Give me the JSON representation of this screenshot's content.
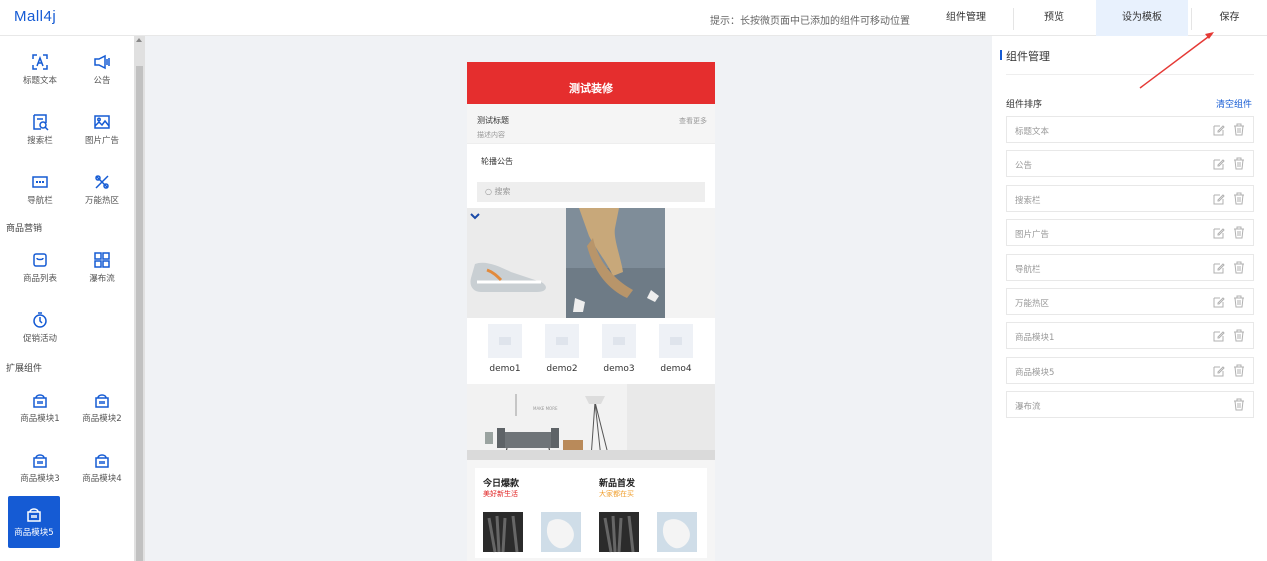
{
  "app": {
    "logo": "Mall4j"
  },
  "topbar": {
    "hint": "提示：长按微页面中已添加的组件可移动位置",
    "component_manage": "组件管理",
    "preview": "预览",
    "set_template": "设为模板",
    "save": "保存"
  },
  "sidebar": {
    "basic": [
      {
        "label": "标题文本",
        "icon": "title-text-icon"
      },
      {
        "label": "公告",
        "icon": "notice-icon"
      },
      {
        "label": "搜索栏",
        "icon": "search-bar-icon"
      },
      {
        "label": "图片广告",
        "icon": "image-ad-icon"
      },
      {
        "label": "导航栏",
        "icon": "navbar-icon"
      },
      {
        "label": "万能热区",
        "icon": "hotzone-icon"
      }
    ],
    "marketing_title": "商品营销",
    "marketing": [
      {
        "label": "商品列表",
        "icon": "goods-list-icon"
      },
      {
        "label": "瀑布流",
        "icon": "waterfall-icon"
      },
      {
        "label": "促销活动",
        "icon": "promotion-icon"
      }
    ],
    "extension_title": "扩展组件",
    "extension": [
      {
        "label": "商品模块1",
        "icon": "basket-icon"
      },
      {
        "label": "商品模块2",
        "icon": "basket-icon"
      },
      {
        "label": "商品模块3",
        "icon": "basket-icon"
      },
      {
        "label": "商品模块4",
        "icon": "basket-icon"
      },
      {
        "label": "商品模块5",
        "icon": "basket-icon"
      }
    ]
  },
  "phone": {
    "header_title": "测试装修",
    "title_block": {
      "title": "测试标题",
      "desc": "描述内容",
      "more": "查看更多"
    },
    "notice": "轮播公告",
    "search_placeholder": "搜索",
    "nav_items": [
      "demo1",
      "demo2",
      "demo3",
      "demo4"
    ],
    "hot_zone_caption": "MAKE MORE",
    "goods": {
      "left_title": "今日爆款",
      "left_sub": "美好新生活",
      "right_title": "新品首发",
      "right_sub": "大家都在买"
    }
  },
  "right_panel": {
    "title": "组件管理",
    "sort_label": "组件排序",
    "clear_label": "清空组件",
    "items": [
      {
        "name": "标题文本",
        "editable": true
      },
      {
        "name": "公告",
        "editable": true
      },
      {
        "name": "搜索栏",
        "editable": true
      },
      {
        "name": "图片广告",
        "editable": true
      },
      {
        "name": "导航栏",
        "editable": true
      },
      {
        "name": "万能热区",
        "editable": true
      },
      {
        "name": "商品模块1",
        "editable": true
      },
      {
        "name": "商品模块5",
        "editable": true
      },
      {
        "name": "瀑布流",
        "editable": false
      }
    ]
  },
  "colors": {
    "accent": "#155bd4",
    "header_red": "#e52e2e",
    "hot_red": "#e02020",
    "sub_orange": "#f0a030"
  }
}
